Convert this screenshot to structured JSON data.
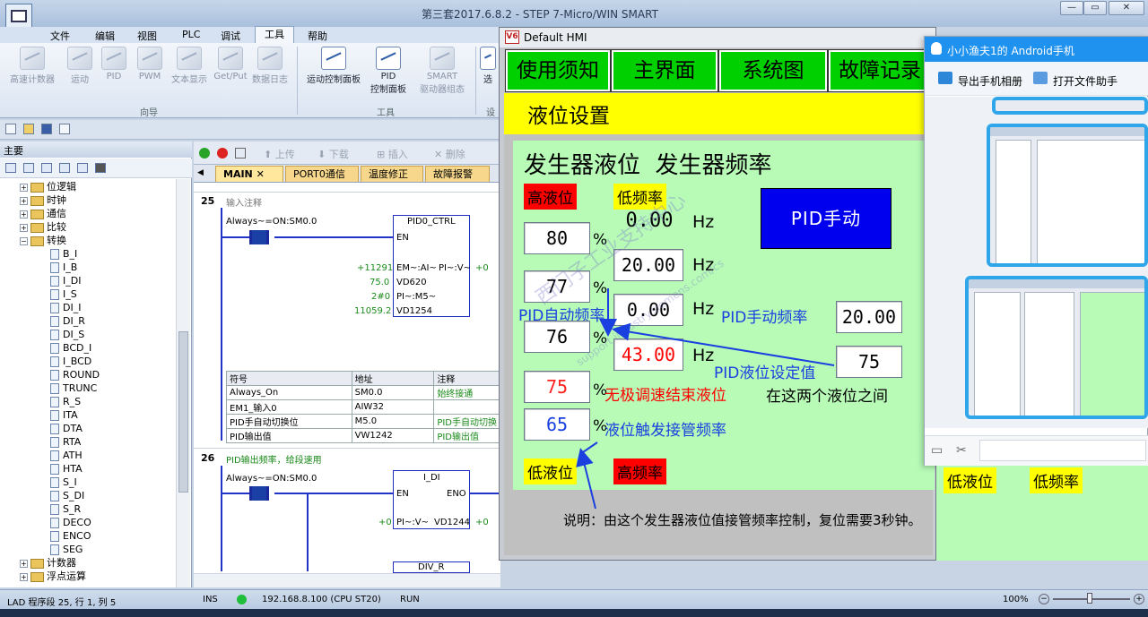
{
  "app": {
    "title": "第三套2017.6.8.2 - STEP 7-Micro/WIN SMART",
    "window_buttons": [
      "—",
      "▭",
      "✕"
    ]
  },
  "menu": [
    "文件",
    "编辑",
    "视图",
    "PLC",
    "调试",
    "工具",
    "帮助"
  ],
  "ribbon": {
    "group1": {
      "label": "向导",
      "buttons": [
        "高速计数器",
        "运动",
        "PID",
        "PWM",
        "文本显示",
        "Get/Put",
        "数据日志"
      ]
    },
    "group2": {
      "label": "工具",
      "buttons": [
        "运动控制面板",
        "PID\n控制面板",
        "SMART\n驱动器组态"
      ]
    },
    "group3": {
      "label": "设",
      "button": "选"
    }
  },
  "tree": {
    "header": "主要",
    "rows": [
      {
        "label": "位逻辑",
        "type": "folder",
        "exp": "+"
      },
      {
        "label": "时钟",
        "type": "folder",
        "exp": "+"
      },
      {
        "label": "通信",
        "type": "folder",
        "exp": "+"
      },
      {
        "label": "比较",
        "type": "folder",
        "exp": "+"
      },
      {
        "label": "转换",
        "type": "folder",
        "exp": "−"
      },
      {
        "label": "B_I",
        "type": "leaf"
      },
      {
        "label": "I_B",
        "type": "leaf"
      },
      {
        "label": "I_DI",
        "type": "leaf"
      },
      {
        "label": "I_S",
        "type": "leaf"
      },
      {
        "label": "DI_I",
        "type": "leaf"
      },
      {
        "label": "DI_R",
        "type": "leaf"
      },
      {
        "label": "DI_S",
        "type": "leaf"
      },
      {
        "label": "BCD_I",
        "type": "leaf"
      },
      {
        "label": "I_BCD",
        "type": "leaf"
      },
      {
        "label": "ROUND",
        "type": "leaf"
      },
      {
        "label": "TRUNC",
        "type": "leaf"
      },
      {
        "label": "R_S",
        "type": "leaf"
      },
      {
        "label": "ITA",
        "type": "leaf"
      },
      {
        "label": "DTA",
        "type": "leaf"
      },
      {
        "label": "RTA",
        "type": "leaf"
      },
      {
        "label": "ATH",
        "type": "leaf"
      },
      {
        "label": "HTA",
        "type": "leaf"
      },
      {
        "label": "S_I",
        "type": "leaf"
      },
      {
        "label": "S_DI",
        "type": "leaf"
      },
      {
        "label": "S_R",
        "type": "leaf"
      },
      {
        "label": "DECO",
        "type": "leaf"
      },
      {
        "label": "ENCO",
        "type": "leaf"
      },
      {
        "label": "SEG",
        "type": "leaf"
      },
      {
        "label": "计数器",
        "type": "folder",
        "exp": "+"
      },
      {
        "label": "浮点运算",
        "type": "folder",
        "exp": "+"
      }
    ]
  },
  "editor": {
    "toolbar": [
      "上传",
      "下载",
      "插入",
      "删除"
    ],
    "tabs": [
      "MAIN",
      "PORT0通信",
      "温度修正",
      "故障报警"
    ],
    "network25": {
      "num": "25",
      "comment": "输入注释",
      "contact": "Always~=ON:SM0.0",
      "box_title": "PID0_CTRL",
      "en": "EN",
      "em": "EM~:AI~",
      "pi": "PI~:V~",
      "pi_out": "+0",
      "inputs": [
        "+11291",
        "75.0",
        "2#0",
        "11059.2"
      ],
      "input_pins": [
        "EM~:AI~",
        "VD620",
        "PI~:M5~",
        "VD1254"
      ],
      "symbol_table": {
        "headers": [
          "符号",
          "地址",
          "注释"
        ],
        "rows": [
          [
            "Always_On",
            "SM0.0",
            "始终接通"
          ],
          [
            "EM1_输入0",
            "AIW32",
            ""
          ],
          [
            "PID手自动切换位",
            "M5.0",
            "PID手自动切换"
          ],
          [
            "PID输出值",
            "VW1242",
            "PID输出值"
          ]
        ]
      }
    },
    "network26": {
      "num": "26",
      "comment": "PID输出频率，给段速用",
      "contact": "Always~=ON:SM0.0",
      "box_title": "I_DI",
      "en": "EN",
      "eno": "ENO",
      "in": "+0",
      "pin": "PI~:V~",
      "out": "VD1244",
      "out_val": "+0",
      "box2_title": "DIV_R"
    }
  },
  "status": {
    "mode": "LAD 程序段 25, 行 1, 列 5",
    "ins": "INS",
    "ip": "192.168.8.100 (CPU ST20)",
    "run": "RUN",
    "zoom": "100%"
  },
  "hmi": {
    "title": "Default HMI",
    "logo": "V6",
    "nav": [
      "使用须知",
      "主界面",
      "系统图",
      "故障记录"
    ],
    "page_title": "液位设置",
    "heading": "发生器液位  发生器频率",
    "labels": {
      "high_level": "高液位",
      "low_freq": "低频率",
      "low_level": "低液位",
      "high_freq": "高频率"
    },
    "level_fields": [
      "80",
      "77",
      "76",
      "75",
      "65"
    ],
    "freq_fields": [
      "0.00",
      "20.00",
      "0.00",
      "43.00"
    ],
    "unit_pct": "%",
    "unit_hz": "Hz",
    "pid_button": "PID手动",
    "pid_auto_freq": "PID自动频率",
    "pid_manual_freq_label": "PID手动频率",
    "pid_manual_freq": "20.00",
    "pid_setpoint_label": "PID液位设定值",
    "pid_setpoint": "75",
    "between_note": "在这两个液位之间",
    "stepless_end": "无极调速结束液位",
    "trigger_freq": "液位触发接管频率",
    "note": "说明：由这个发生器液位值接管频率控制，复位需要3秒钟。",
    "watermark": "西门子工业支持中心",
    "watermark2": "support.industry.siemens.com/cs"
  },
  "phone": {
    "title": "小小渔夫1的 Android手机",
    "actions": [
      "导出手机相册",
      "打开文件助手"
    ],
    "strip_labels": [
      "低液位",
      "低频率"
    ]
  },
  "colors": {
    "hmi_green": "#00d000",
    "hmi_yellow": "#ffff00",
    "panel_green": "#b7fbb7",
    "pid_blue": "#0000ee",
    "red": "#ff0000",
    "qq_blue": "#1f91ee"
  }
}
